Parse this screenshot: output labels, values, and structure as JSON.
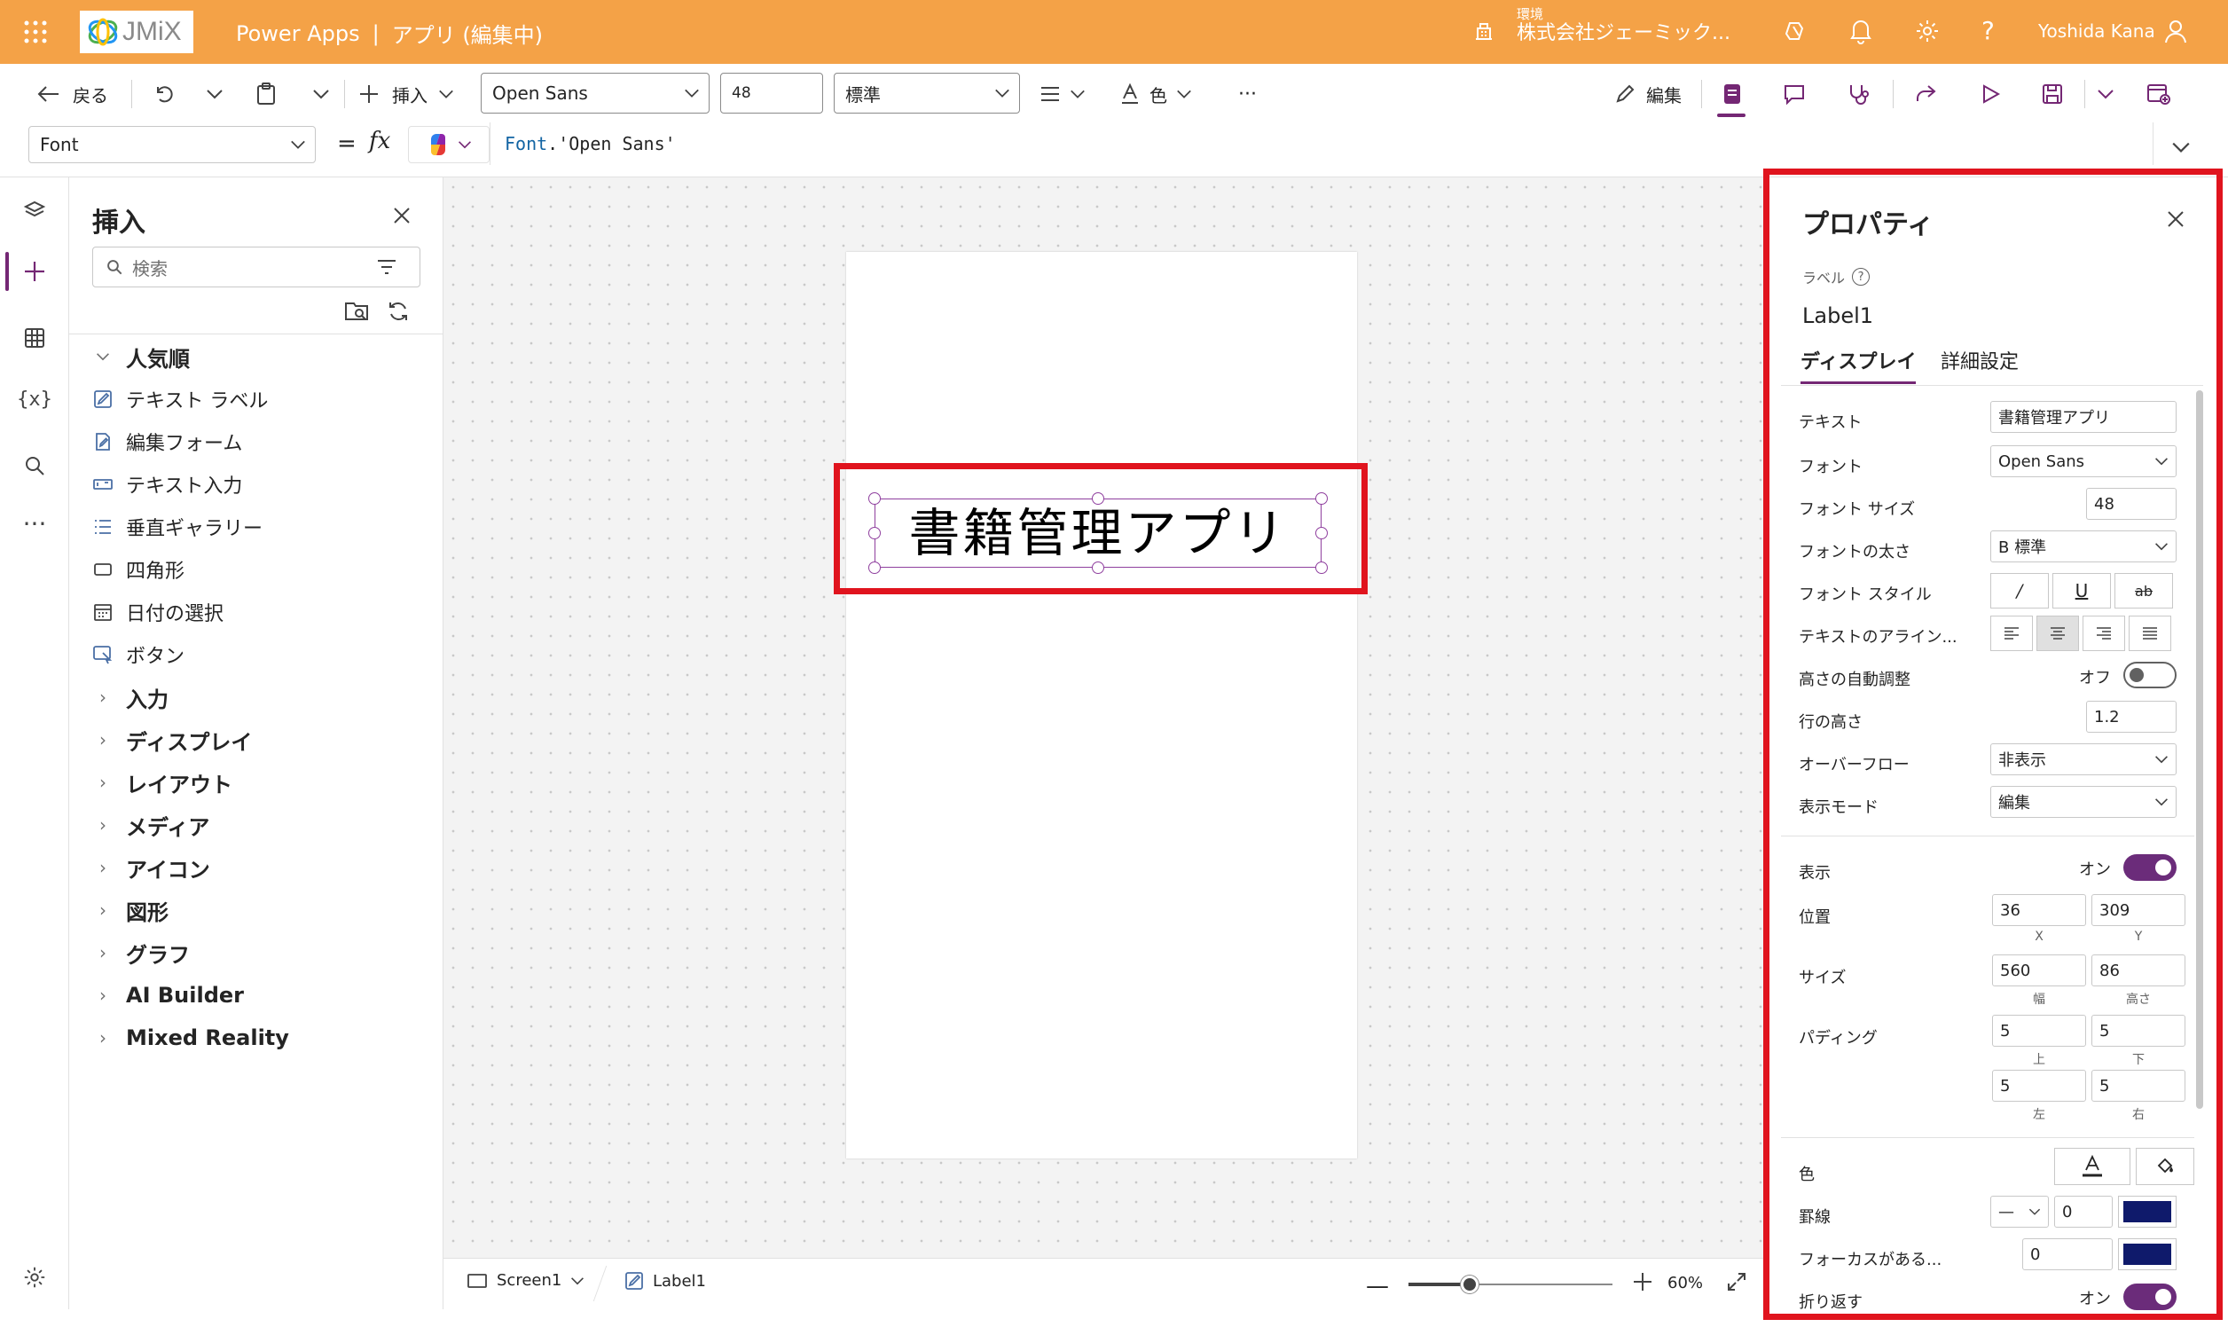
{
  "topbar": {
    "app_name": "Power Apps",
    "separator": "|",
    "app_title": "アプリ (編集中)",
    "env_label": "環境",
    "env_name": "株式会社ジェーミック...",
    "user_name": "Yoshida Kana",
    "logo_text": "JMiX",
    "bg_color": "#f4a247"
  },
  "toolbar": {
    "back": "戻る",
    "insert": "挿入",
    "font": "Open Sans",
    "font_size": "48",
    "weight": "標準",
    "color": "色",
    "more": "···",
    "edit": "編集"
  },
  "formula_bar": {
    "property": "Font",
    "equals": "=",
    "fx": "fx",
    "formula_keyword": "Font",
    "formula_value": ".'Open Sans'"
  },
  "insert_panel": {
    "title": "挿入",
    "search_placeholder": "検索",
    "popular_header": "人気順",
    "popular_items": [
      "テキスト ラベル",
      "編集フォーム",
      "テキスト入力",
      "垂直ギャラリー",
      "四角形",
      "日付の選択",
      "ボタン"
    ],
    "categories": [
      "入力",
      "ディスプレイ",
      "レイアウト",
      "メディア",
      "アイコン",
      "図形",
      "グラフ",
      "AI Builder",
      "Mixed Reality"
    ]
  },
  "canvas": {
    "label_text": "書籍管理アプリ",
    "highlight_color": "#e0141e"
  },
  "statusbar": {
    "screen": "Screen1",
    "control": "Label1",
    "zoom": "60%",
    "zoom_level": 0.3
  },
  "properties": {
    "title": "プロパティ",
    "type_label": "ラベル",
    "control_name": "Label1",
    "tab_display": "ディスプレイ",
    "tab_advanced": "詳細設定",
    "text_label": "テキスト",
    "text_value": "書籍管理アプリ",
    "font_label": "フォント",
    "font_value": "Open Sans",
    "font_size_label": "フォント サイズ",
    "font_size_value": "48",
    "font_weight_label": "フォントの太さ",
    "font_weight_value": "B 標準",
    "font_style_label": "フォント スタイル",
    "align_label": "テキストのアライン...",
    "auto_height_label": "高さの自動調整",
    "auto_height_state": "オフ",
    "line_height_label": "行の高さ",
    "line_height_value": "1.2",
    "overflow_label": "オーバーフロー",
    "overflow_value": "非表示",
    "display_mode_label": "表示モード",
    "display_mode_value": "編集",
    "visible_label": "表示",
    "visible_state": "オン",
    "position_label": "位置",
    "pos_x": "36",
    "pos_y": "309",
    "x_sub": "X",
    "y_sub": "Y",
    "size_label": "サイズ",
    "width": "560",
    "height": "86",
    "width_sub": "幅",
    "height_sub": "高さ",
    "padding_label": "パディング",
    "pad_top": "5",
    "pad_bottom": "5",
    "pad_left": "5",
    "pad_right": "5",
    "pad_top_sub": "上",
    "pad_bottom_sub": "下",
    "pad_left_sub": "左",
    "pad_right_sub": "右",
    "color_label": "色",
    "border_label": "罫線",
    "border_style": "—",
    "border_width": "0",
    "focus_label": "フォーカスがある...",
    "focus_width": "0",
    "wrap_label": "折り返す",
    "wrap_state": "オン",
    "border_color": "#0f1a6b",
    "toggle_color": "#6b2c7a"
  }
}
